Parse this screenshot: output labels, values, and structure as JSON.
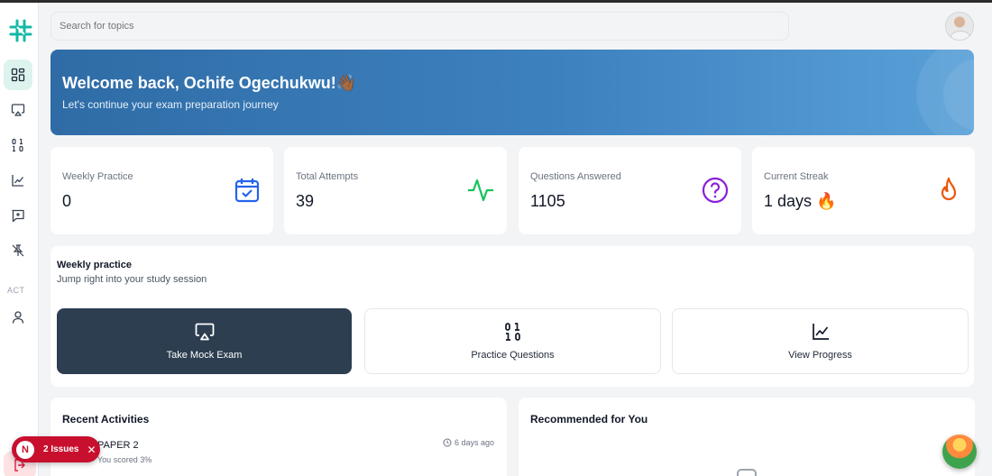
{
  "search": {
    "placeholder": "Search for topics"
  },
  "sidebar": {
    "section_label": "ACT",
    "items": [
      {
        "name": "dashboard",
        "icon": "dashboard-grid-icon"
      },
      {
        "name": "mock-exam",
        "icon": "airplay-icon"
      },
      {
        "name": "practice",
        "icon": "binary-icon"
      },
      {
        "name": "progress",
        "icon": "chart-line-icon"
      },
      {
        "name": "messages",
        "icon": "message-plus-icon"
      },
      {
        "name": "unpinned",
        "icon": "pin-off-icon"
      },
      {
        "name": "account",
        "icon": "user-icon"
      },
      {
        "name": "logout",
        "icon": "logout-icon"
      }
    ]
  },
  "hero": {
    "title": "Welcome back, Ochife Ogechukwu!👋🏾",
    "subtitle": "Let's continue your exam preparation journey"
  },
  "stats": [
    {
      "label": "Weekly Practice",
      "value": "0",
      "icon": "calendar-check-icon",
      "color": "#2563eb"
    },
    {
      "label": "Total Attempts",
      "value": "39",
      "icon": "activity-icon",
      "color": "#16c35b"
    },
    {
      "label": "Questions Answered",
      "value": "1105",
      "icon": "help-circle-icon",
      "color": "#8b1fd6"
    },
    {
      "label": "Current Streak",
      "value": "1 days 🔥",
      "icon": "flame-icon",
      "color": "#ea580c"
    }
  ],
  "practice": {
    "title": "Weekly practice",
    "subtitle": "Jump right into your study session",
    "actions": [
      {
        "label": "Take Mock Exam",
        "icon": "airplay-icon"
      },
      {
        "label": "Practice Questions",
        "icon": "binary-icon"
      },
      {
        "label": "View Progress",
        "icon": "chart-line-icon"
      }
    ]
  },
  "recent": {
    "title": "Recent Activities",
    "item": {
      "name": "PAPER 2",
      "score": "You scored 3%",
      "time": "6 days ago"
    }
  },
  "recommended": {
    "title": "Recommended for You"
  },
  "issues": {
    "label": "2 Issues",
    "logo": "N",
    "close": "✕"
  },
  "colors": {
    "accent": "#2c3e50",
    "brand": "#14b8a6",
    "hero_start": "#2f6ca6",
    "hero_end": "#5aa1d8",
    "issues": "#c8102e"
  }
}
